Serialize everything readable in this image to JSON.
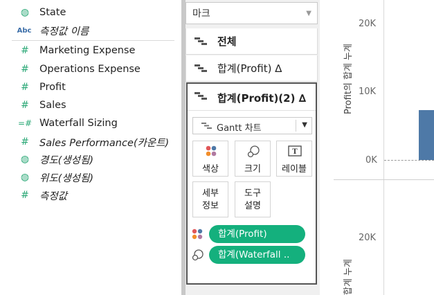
{
  "data_pane": {
    "partial_top": "",
    "fields": [
      {
        "icon": "globe-icon",
        "glyph": "◍",
        "label": "State",
        "italic": false
      },
      {
        "icon": "abc-icon",
        "glyph": "Abc",
        "label": "측정값 이름",
        "italic": true
      },
      {
        "icon": "hash-icon",
        "glyph": "#",
        "label": "Marketing Expense",
        "italic": false
      },
      {
        "icon": "hash-icon",
        "glyph": "#",
        "label": "Operations Expense",
        "italic": false
      },
      {
        "icon": "hash-icon",
        "glyph": "#",
        "label": "Profit",
        "italic": false
      },
      {
        "icon": "hash-icon",
        "glyph": "#",
        "label": "Sales",
        "italic": false
      },
      {
        "icon": "parameter-hash-icon",
        "glyph": "=#",
        "label": "Waterfall Sizing",
        "italic": false
      },
      {
        "icon": "hash-icon",
        "glyph": "#",
        "label": "Sales Performance(카운트)",
        "italic": true
      },
      {
        "icon": "globe-icon",
        "glyph": "◍",
        "label": "경도(생성됨)",
        "italic": true
      },
      {
        "icon": "globe-icon",
        "glyph": "◍",
        "label": "위도(생성됨)",
        "italic": true
      },
      {
        "icon": "hash-icon",
        "glyph": "#",
        "label": "측정값",
        "italic": true
      }
    ]
  },
  "marks": {
    "header": "마크",
    "rows": [
      {
        "label": "전체"
      },
      {
        "label": "합계(Profit) ∆"
      }
    ],
    "active_card": {
      "title": "합계(Profit)(2) ∆",
      "mark_type": "Gantt 차트",
      "buttons": [
        {
          "label": "색상",
          "icon": "color-icon"
        },
        {
          "label": "크기",
          "icon": "size-icon"
        },
        {
          "label": "레이블",
          "icon": "label-icon"
        },
        {
          "label": "세부\n정보",
          "icon": "detail-icon"
        },
        {
          "label": "도구\n설명",
          "icon": "tooltip-icon"
        }
      ],
      "pills": [
        {
          "text": "합계(Profit)",
          "icon": "color-icon"
        },
        {
          "text": "합계(Waterfall ..",
          "icon": "size-icon"
        }
      ]
    }
  },
  "view": {
    "axis_title_top": "Profit의 합계 누계",
    "axis_title_bottom": "합계 누계",
    "ticks_top": [
      "20K",
      "10K",
      "0K"
    ],
    "ticks_bottom": [
      "20K"
    ],
    "bar_color": "#4e79a7",
    "accent_color": "#14b07d"
  }
}
